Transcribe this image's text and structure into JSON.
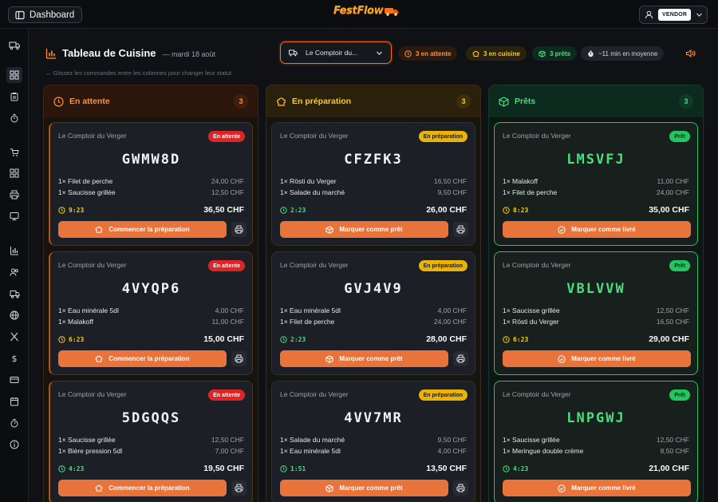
{
  "topbar": {
    "dashboard_label": "Dashboard",
    "logo_text": "FestFlow",
    "vendor_label": "VENDOR"
  },
  "header": {
    "title": "Tableau de Cuisine",
    "date": "— mardi 18 août",
    "hint": "↔ Glissez les commandes entre les colonnes pour changer leur statut",
    "vendor_select": "Le Comptoir du...",
    "chips": {
      "waiting": "3 en attente",
      "cooking": "3 en cuisine",
      "ready": "3 prêts",
      "average": "~11 min en moyenne"
    }
  },
  "colors": {
    "accent_orange": "#e8743b",
    "waiting": "#fb923c",
    "cooking": "#facc15",
    "ready": "#4ade80",
    "badge_waiting": "#dc2626"
  },
  "columns": {
    "waiting": {
      "title": "En attente",
      "count": "3",
      "action_label": "Commencer la préparation",
      "orders": [
        {
          "vendor": "Le Comptoir du Verger",
          "status": "En attente",
          "code": "GWMW8D",
          "items": [
            {
              "name": "1× Filet de perche",
              "price": "24,00 CHF"
            },
            {
              "name": "1× Saucisse grillée",
              "price": "12,50 CHF"
            }
          ],
          "timer": "9:23",
          "total": "36,50 CHF"
        },
        {
          "vendor": "Le Comptoir du Verger",
          "status": "En attente",
          "code": "4VYQP6",
          "items": [
            {
              "name": "1× Eau minérale 5dl",
              "price": "4,00 CHF"
            },
            {
              "name": "1× Malakoff",
              "price": "11,00 CHF"
            }
          ],
          "timer": "6:23",
          "total": "15,00 CHF"
        },
        {
          "vendor": "Le Comptoir du Verger",
          "status": "En attente",
          "code": "5DGQQS",
          "items": [
            {
              "name": "1× Saucisse grillée",
              "price": "12,50 CHF"
            },
            {
              "name": "1× Bière pression 5dl",
              "price": "7,00 CHF"
            }
          ],
          "timer": "4:23",
          "total": "19,50 CHF"
        }
      ]
    },
    "cooking": {
      "title": "En préparation",
      "count": "3",
      "action_label": "Marquer comme prêt",
      "orders": [
        {
          "vendor": "Le Comptoir du Verger",
          "status": "En préparation",
          "code": "CFZFK3",
          "items": [
            {
              "name": "1× Rösti du Verger",
              "price": "16,50 CHF"
            },
            {
              "name": "1× Salade du marché",
              "price": "9,50 CHF"
            }
          ],
          "timer": "2:23",
          "total": "26,00 CHF"
        },
        {
          "vendor": "Le Comptoir du Verger",
          "status": "En préparation",
          "code": "GVJ4V9",
          "items": [
            {
              "name": "1× Eau minérale 5dl",
              "price": "4,00 CHF"
            },
            {
              "name": "1× Filet de perche",
              "price": "24,00 CHF"
            }
          ],
          "timer": "2:23",
          "total": "28,00 CHF"
        },
        {
          "vendor": "Le Comptoir du Verger",
          "status": "En préparation",
          "code": "4VV7MR",
          "items": [
            {
              "name": "1× Salade du marché",
              "price": "9,50 CHF"
            },
            {
              "name": "1× Eau minérale 5dl",
              "price": "4,00 CHF"
            }
          ],
          "timer": "1:51",
          "total": "13,50 CHF"
        }
      ]
    },
    "ready": {
      "title": "Prêts",
      "count": "3",
      "action_label": "Marquer comme livré",
      "orders": [
        {
          "vendor": "Le Comptoir du Verger",
          "status": "Prêt",
          "code": "LMSVFJ",
          "items": [
            {
              "name": "1× Malakoff",
              "price": "11,00 CHF"
            },
            {
              "name": "1× Filet de perche",
              "price": "24,00 CHF"
            }
          ],
          "timer": "8:23",
          "total": "35,00 CHF"
        },
        {
          "vendor": "Le Comptoir du Verger",
          "status": "Prêt",
          "code": "VBLVVW",
          "items": [
            {
              "name": "1× Saucisse grillée",
              "price": "12,50 CHF"
            },
            {
              "name": "1× Rösti du Verger",
              "price": "16,50 CHF"
            }
          ],
          "timer": "6:23",
          "total": "29,00 CHF"
        },
        {
          "vendor": "Le Comptoir du Verger",
          "status": "Prêt",
          "code": "LNPGWJ",
          "items": [
            {
              "name": "1× Saucisse grillée",
              "price": "12,50 CHF"
            },
            {
              "name": "1× Meringue double crème",
              "price": "8,50 CHF"
            }
          ],
          "timer": "4:23",
          "total": "21,00 CHF"
        }
      ]
    }
  }
}
